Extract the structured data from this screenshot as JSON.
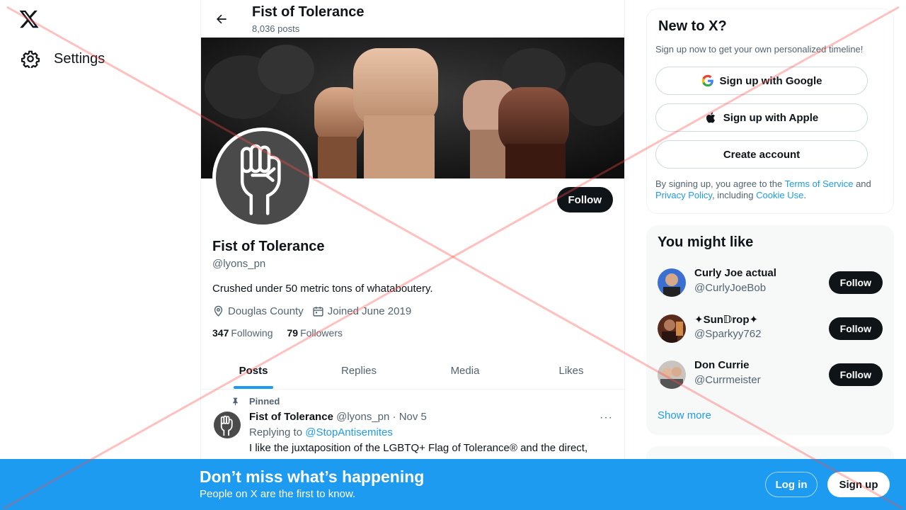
{
  "nav": {
    "settings_label": "Settings"
  },
  "header": {
    "title": "Fist of Tolerance",
    "post_count": "8,036 posts"
  },
  "profile": {
    "name": "Fist of Tolerance",
    "handle": "@lyons_pn",
    "bio": "Crushed under 50 metric tons of whataboutery.",
    "location": "Douglas County",
    "joined": "Joined June 2019",
    "following_count": "347",
    "following_label": "Following",
    "followers_count": "79",
    "followers_label": "Followers",
    "follow_label": "Follow"
  },
  "tabs": [
    {
      "label": "Posts"
    },
    {
      "label": "Replies"
    },
    {
      "label": "Media"
    },
    {
      "label": "Likes"
    }
  ],
  "post": {
    "pinned_label": "Pinned",
    "author": "Fist of Tolerance",
    "meta": "@lyons_pn · Nov 5",
    "replying_prefix": "Replying to",
    "replying_to": "@StopAntisemites",
    "text": "I like the juxtaposition of the LGBTQ+ Flag of Tolerance® and the direct,",
    "more": "···"
  },
  "signup_card": {
    "title": "New to X?",
    "subtitle": "Sign up now to get your own personalized timeline!",
    "google_label": "Sign up with Google",
    "apple_label": "Sign up with Apple",
    "create_label": "Create account",
    "terms_prefix": "By signing up, you agree to the",
    "terms_link": "Terms of Service",
    "and": "and",
    "privacy_link": "Privacy Policy",
    "including": ", including",
    "cookie_link": "Cookie Use",
    "period": "."
  },
  "suggestions": {
    "title": "You might like",
    "items": [
      {
        "name": "Curly Joe actual",
        "handle": "@CurlyJoeBob",
        "follow": "Follow"
      },
      {
        "name": "✦Sun𝔻rop✦",
        "handle": "@Sparkyy762",
        "follow": "Follow"
      },
      {
        "name": "Don Currie",
        "handle": "@Currmeister",
        "follow": "Follow"
      }
    ],
    "show_more": "Show more"
  },
  "bottom_bar": {
    "headline": "Don’t miss what’s happening",
    "subline": "People on X are the first to know.",
    "login_label": "Log in",
    "signup_label": "Sign up"
  },
  "colors": {
    "accent": "#1d9bf0",
    "text": "#0f1419",
    "muted": "#536471"
  }
}
